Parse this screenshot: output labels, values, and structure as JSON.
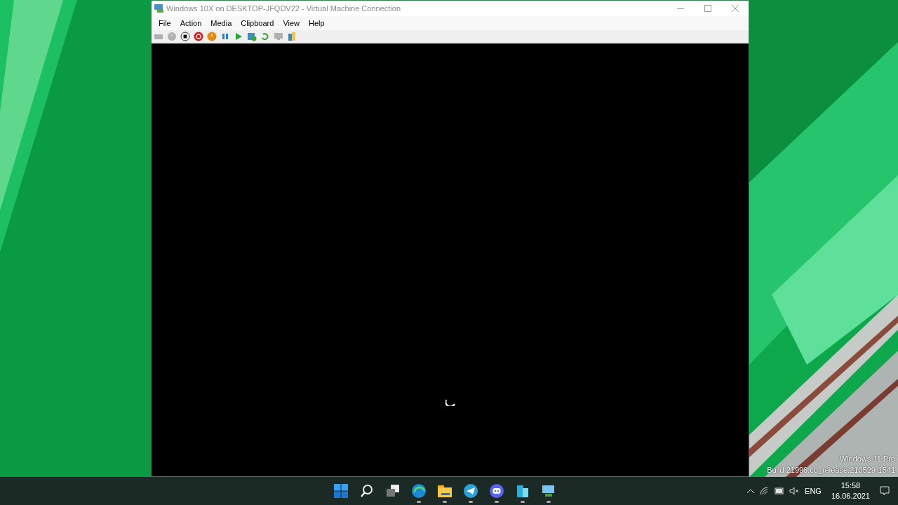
{
  "window": {
    "title": "Windows 10X on DESKTOP-JFQDV22 - Virtual Machine Connection",
    "menu": [
      "File",
      "Action",
      "Media",
      "Clipboard",
      "View",
      "Help"
    ],
    "toolbar": [
      {
        "kind": "ctrlaltdel",
        "disabled": true
      },
      {
        "kind": "start",
        "disabled": true
      },
      {
        "kind": "turnoff",
        "disabled": false
      },
      {
        "kind": "shutdown",
        "disabled": false
      },
      {
        "kind": "save",
        "disabled": false
      },
      {
        "kind": "pause",
        "disabled": false
      },
      {
        "kind": "resume",
        "disabled": false
      },
      {
        "kind": "checkpoint",
        "disabled": false
      },
      {
        "kind": "revert",
        "disabled": false
      },
      {
        "kind": "enhanced",
        "disabled": true
      },
      {
        "kind": "share",
        "disabled": false
      }
    ]
  },
  "watermark": [
    "Windows 11 Pro",
    "Build 21996.co_release.210529-1541"
  ],
  "taskbar": {
    "apps": [
      {
        "kind": "start",
        "running": false
      },
      {
        "kind": "search",
        "running": false
      },
      {
        "kind": "taskview",
        "running": false
      },
      {
        "kind": "browser",
        "running": true
      },
      {
        "kind": "folder",
        "running": true
      },
      {
        "kind": "telegram",
        "running": true
      },
      {
        "kind": "discord",
        "running": true
      },
      {
        "kind": "blocks",
        "running": true
      },
      {
        "kind": "vm",
        "running": true
      }
    ],
    "language": "ENG",
    "time": "15:58",
    "date": "16.06.2021"
  }
}
